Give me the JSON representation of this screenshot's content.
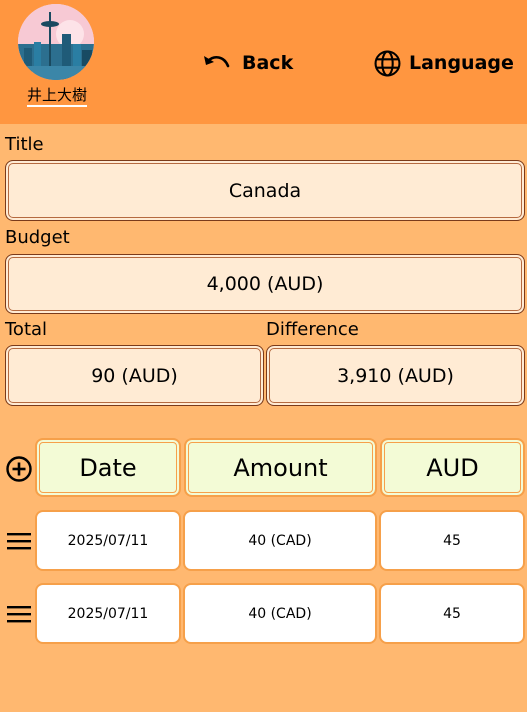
{
  "header": {
    "username": "井上大樹",
    "back_label": "Back",
    "language_label": "Language"
  },
  "form": {
    "title_label": "Title",
    "title_value": "Canada",
    "budget_label": "Budget",
    "budget_value": "4,000 (AUD)",
    "total_label": "Total",
    "total_value": "90 (AUD)",
    "difference_label": "Difference",
    "difference_value": "3,910 (AUD)"
  },
  "table": {
    "columns": [
      "Date",
      "Amount",
      "AUD"
    ],
    "rows": [
      {
        "date": "2025/07/11",
        "amount": "40 (CAD)",
        "aud": "45"
      },
      {
        "date": "2025/07/11",
        "amount": "40 (CAD)",
        "aud": "45"
      }
    ]
  },
  "colors": {
    "header_bg": "#ff9640",
    "page_bg": "#ffb870",
    "field_bg": "#ffebd4",
    "table_header_bg": "#f3fbd6",
    "cell_border": "#f6a04a"
  }
}
